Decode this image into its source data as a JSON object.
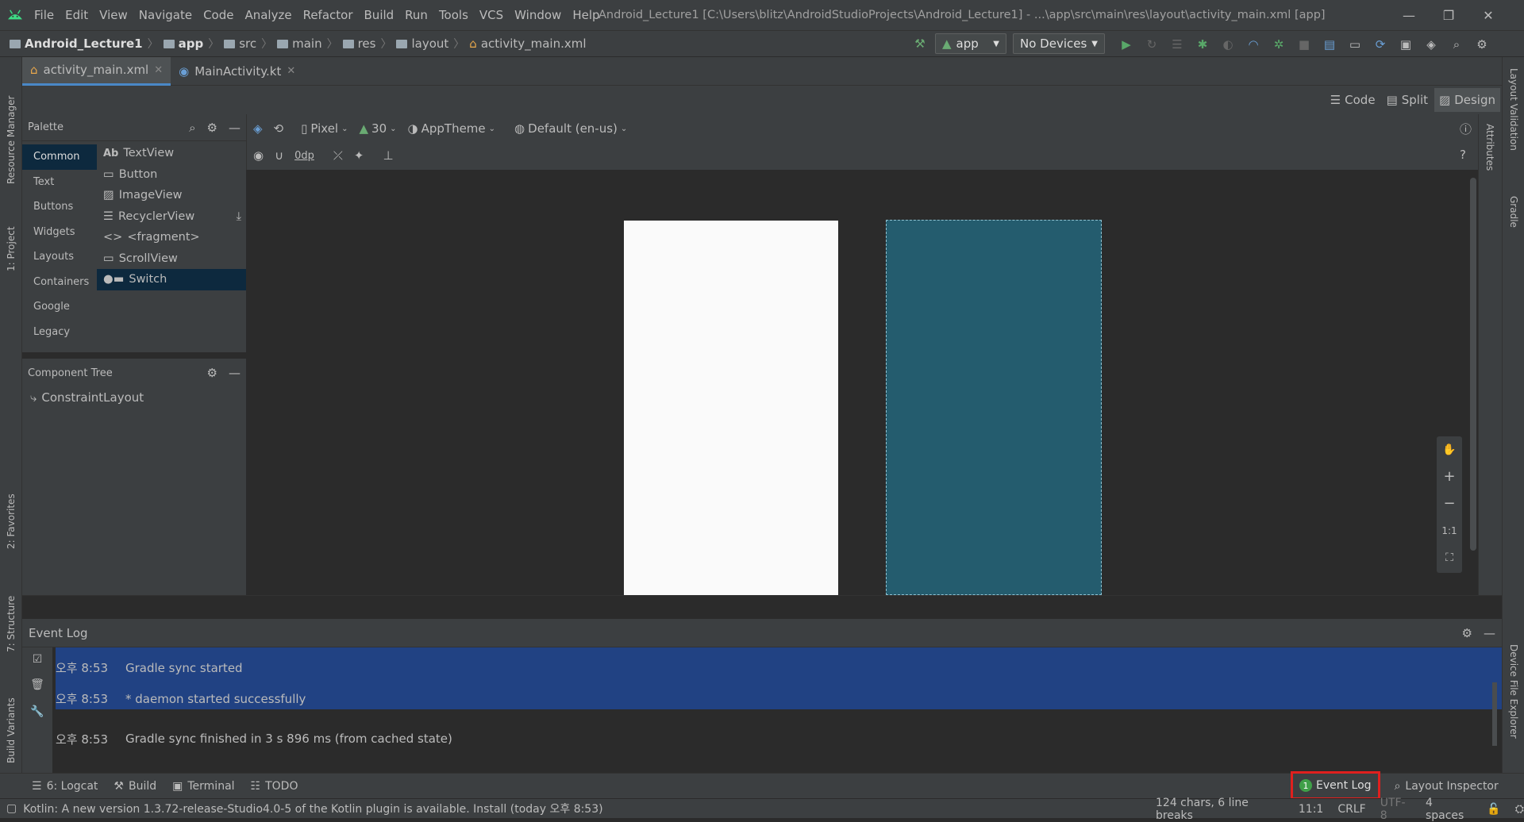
{
  "window": {
    "title": "Android_Lecture1 [C:\\Users\\blitz\\AndroidStudioProjects\\Android_Lecture1] - ...\\app\\src\\main\\res\\layout\\activity_main.xml [app]",
    "menus": [
      "File",
      "Edit",
      "View",
      "Navigate",
      "Code",
      "Analyze",
      "Refactor",
      "Build",
      "Run",
      "Tools",
      "VCS",
      "Window",
      "Help"
    ],
    "controls": {
      "minimize": "—",
      "restore": "❐",
      "close": "✕"
    }
  },
  "breadcrumb": {
    "project": "Android_Lecture1",
    "items": [
      "app",
      "src",
      "main",
      "res",
      "layout",
      "activity_main.xml"
    ]
  },
  "toolbar": {
    "config": "app",
    "device": "No Devices",
    "icons": [
      "hammer-icon",
      "run-icon",
      "rerun-icon",
      "apply-changes-icon",
      "debug-icon",
      "coverage-icon",
      "profile-icon",
      "attach-debugger-icon",
      "stop-icon",
      "project-structure-icon",
      "avd-manager-icon",
      "sync-icon",
      "sdk-manager-icon",
      "device-manager-icon",
      "search-icon",
      "settings-icon"
    ]
  },
  "left_strip": {
    "resource_manager": "Resource Manager",
    "project": "1: Project",
    "favorites": "2: Favorites",
    "structure": "7: Structure",
    "build_variants": "Build Variants"
  },
  "right_strip": {
    "layout_validation": "Layout Validation",
    "attributes": "Attributes",
    "gradle": "Gradle",
    "device_file_explorer": "Device File Explorer"
  },
  "tabs": [
    {
      "label": "activity_main.xml",
      "active": true
    },
    {
      "label": "MainActivity.kt",
      "active": false
    }
  ],
  "view_modes": [
    {
      "label": "Code"
    },
    {
      "label": "Split"
    },
    {
      "label": "Design",
      "active": true
    }
  ],
  "palette": {
    "title": "Palette",
    "categories": [
      "Common",
      "Text",
      "Buttons",
      "Widgets",
      "Layouts",
      "Containers",
      "Google",
      "Legacy"
    ],
    "selected_category": "Common",
    "widgets": [
      {
        "icon": "Ab",
        "label": "TextView"
      },
      {
        "icon": "▭",
        "label": "Button"
      },
      {
        "icon": "▨",
        "label": "ImageView"
      },
      {
        "icon": "☰",
        "label": "RecyclerView"
      },
      {
        "icon": "<>",
        "label": "<fragment>"
      },
      {
        "icon": "▭",
        "label": "ScrollView"
      },
      {
        "icon": "●▬",
        "label": "Switch"
      }
    ],
    "selected_widget": "Switch"
  },
  "component_tree": {
    "title": "Component Tree",
    "root": "ConstraintLayout"
  },
  "design_toolbar": {
    "device": "Pixel",
    "api": "30",
    "theme": "AppTheme",
    "locale": "Default (en-us)",
    "margin": "0dp"
  },
  "zoom": {
    "one_to_one": "1:1"
  },
  "event_log": {
    "title": "Event Log",
    "entries": [
      {
        "time": "오후 8:53",
        "message": "Gradle sync started",
        "highlighted": true
      },
      {
        "time": "오후 8:53",
        "message": "* daemon started successfully",
        "highlighted": true
      },
      {
        "time": "오후 8:53",
        "message": "Gradle sync finished in 3 s 896 ms (from cached state)",
        "highlighted": false
      }
    ]
  },
  "bottom_tools": {
    "logcat": "6: Logcat",
    "build": "Build",
    "terminal": "Terminal",
    "todo": "TODO",
    "event_log_badge": "1",
    "event_log": "Event Log",
    "layout_inspector": "Layout Inspector"
  },
  "status_bar": {
    "message": "Kotlin: A new version 1.3.72-release-Studio4.0-5 of the Kotlin plugin is available. Install (today 오후 8:53)",
    "chars": "124 chars, 6 line breaks",
    "position": "11:1",
    "line_sep": "CRLF",
    "encoding": "UTF-8",
    "indent": "4 spaces"
  },
  "colors": {
    "blueprint": "#245c6e",
    "design_surface": "#fafafa",
    "selection": "#214283",
    "highlight_box": "#e0201e"
  }
}
